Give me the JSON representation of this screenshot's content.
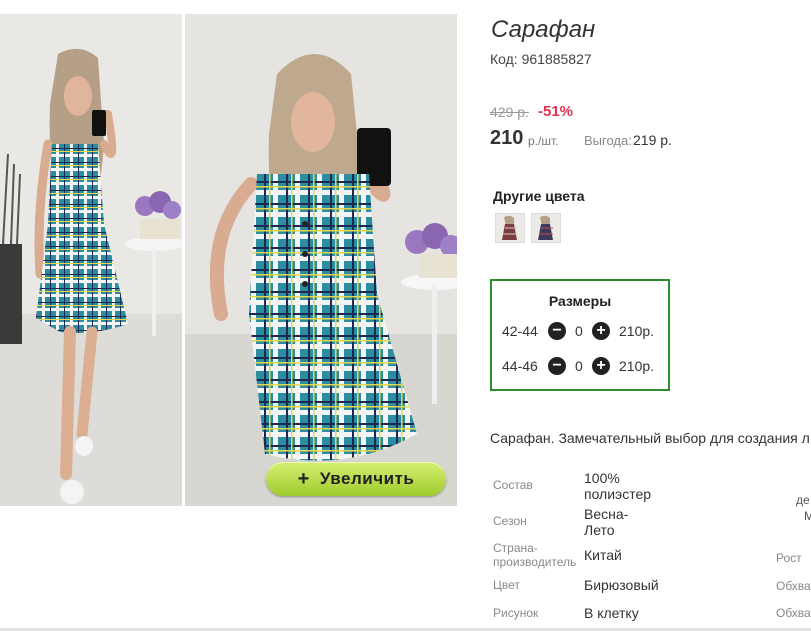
{
  "zoom_button": {
    "icon": "plus-icon",
    "label": "Увеличить"
  },
  "product": {
    "title": "Сарафан",
    "code": "Код: 961885827",
    "old_price": "429 р.",
    "discount": "-51%",
    "price": "210",
    "price_unit": "р./шт.",
    "saving_label": "Выгода:",
    "saving_value": "219 р."
  },
  "other_colors": {
    "title": "Другие цвета",
    "count": 2
  },
  "sizes": {
    "title": "Размеры",
    "rows": [
      {
        "size": "42-44",
        "qty": "0",
        "price": "210р."
      },
      {
        "size": "44-46",
        "qty": "0",
        "price": "210р."
      }
    ]
  },
  "description": "Сарафан. Замечательный выбор для создания л",
  "specs": [
    {
      "label": "Состав",
      "value": "100% полиэстер"
    },
    {
      "label": "Сезон",
      "value": "Весна-Лето"
    },
    {
      "label": "Страна-производитель",
      "value": "Китай"
    },
    {
      "label": "Цвет",
      "value": "Бирюзовый"
    },
    {
      "label": "Рисунок",
      "value": "В клетку"
    }
  ],
  "specs_right": [
    "Рост",
    "Обхват",
    "Обхват"
  ],
  "specs_right_top": [
    "де",
    "М"
  ],
  "colors": {
    "accent_green": "#2b8c2b",
    "discount_red": "#e0304d",
    "button_green": "#9fcb2c"
  }
}
